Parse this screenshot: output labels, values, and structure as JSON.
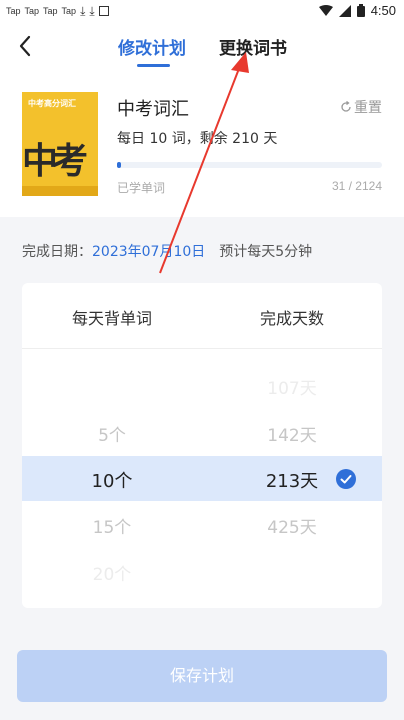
{
  "status_bar": {
    "apps": [
      "Tap",
      "Tap",
      "Tap",
      "Tap"
    ],
    "time": "4:50",
    "icons": [
      "download-icon",
      "download-icon",
      "image-icon",
      "wifi-icon",
      "signal-icon",
      "battery-icon"
    ]
  },
  "nav": {
    "back_icon": "back-arrow-icon",
    "tab_edit": "修改计划",
    "tab_change": "更换词书"
  },
  "book": {
    "cover_top": "中考高分词汇",
    "cover_big": "中考",
    "title": "中考词汇",
    "reset_label": "重置",
    "subtitle": "每日 10 词，剩余 210 天",
    "progress": 0.0146,
    "learned_label": "已学单词",
    "learned_count": "31 / 2124"
  },
  "finish": {
    "label": "完成日期：",
    "date": "2023年07月10日",
    "estimate": "预计每天5分钟"
  },
  "picker": {
    "col_words": "每天背单词",
    "col_days": "完成天数",
    "words": [
      "5个",
      "10个",
      "15个",
      "20个"
    ],
    "days": [
      "107天",
      "142天",
      "213天",
      "425天"
    ],
    "selected_words": "10个",
    "selected_days": "213天"
  },
  "save_button": "保存计划",
  "colors": {
    "accent": "#2f6fd8",
    "selected_row": "#dce8fb",
    "save_disabled": "#bcd1f5",
    "annotation_arrow": "#e8392e"
  }
}
